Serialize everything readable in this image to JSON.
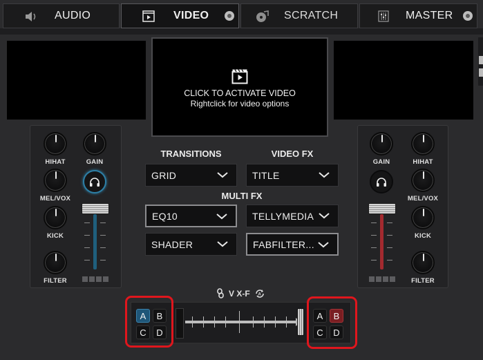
{
  "tabs": [
    {
      "label": "AUDIO",
      "icon": "speaker-icon",
      "active": false
    },
    {
      "label": "VIDEO",
      "icon": "film-play-icon",
      "active": true
    },
    {
      "label": "SCRATCH",
      "icon": "turntable-icon",
      "active": false
    },
    {
      "label": "MASTER",
      "icon": "mixer-icon",
      "active": false
    }
  ],
  "video": {
    "activate_text": "CLICK TO ACTIVATE VIDEO",
    "options_text": "Rightclick for video options"
  },
  "left_deck": {
    "knobs": {
      "hihat": "HIHAT",
      "gain": "GAIN",
      "melvox": "MEL/VOX",
      "kick": "KICK",
      "filter": "FILTER"
    },
    "fader_level": 0.78,
    "headphone_active": true,
    "accent": "#2d7fa6"
  },
  "right_deck": {
    "knobs": {
      "gain": "GAIN",
      "hihat": "HIHAT",
      "melvox": "MEL/VOX",
      "kick": "KICK",
      "filter": "FILTER"
    },
    "fader_level": 0.78,
    "headphone_active": false,
    "accent": "#b0282e"
  },
  "fx": {
    "transitions_label": "TRANSITIONS",
    "videofx_label": "VIDEO FX",
    "multifx_label": "MULTI FX",
    "transition_value": "GRID",
    "videofx_value": "TITLE",
    "multi_left_1": "EQ10",
    "multi_right_1": "TELLYMEDIA",
    "multi_left_2": "SHADER",
    "multi_right_2": "FABFILTER..."
  },
  "crossfader": {
    "label": "V X-F",
    "position": 1.0,
    "left_buttons": {
      "a": "A",
      "b": "B",
      "c": "C",
      "d": "D",
      "selected": "A"
    },
    "right_buttons": {
      "a": "A",
      "b": "B",
      "c": "C",
      "d": "D",
      "selected": "B"
    }
  }
}
